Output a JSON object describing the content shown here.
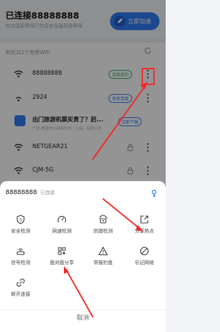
{
  "header": {
    "title": "已连接88888888",
    "subtitle": "符合国家等保行信息安全最高保等保",
    "accelerate_label": "立即加速"
  },
  "nearby_label": "附近共2个免费WiFi",
  "networks": [
    {
      "name": "88888888",
      "badge": "连接成功",
      "kind": "connected"
    },
    {
      "name": "2924",
      "badge": "免密连接",
      "kind": "free"
    },
    {
      "name": "出门旅游机票买贵了？赶...",
      "sub": "广告 携程旅行网络科技（上海）有限公司",
      "badge": "立即下载",
      "kind": "ad"
    },
    {
      "name": "NETGEAR21",
      "kind": "locked"
    },
    {
      "name": "CJM-5G",
      "kind": "locked"
    }
  ],
  "sheet": {
    "ssid": "88888888",
    "status": "已连接",
    "actions": [
      {
        "label": "安全检测",
        "icon": "shield-s-icon"
      },
      {
        "label": "网速检测",
        "icon": "speedometer-icon"
      },
      {
        "label": "防蹭检测",
        "icon": "anti-leech-icon"
      },
      {
        "label": "分享热点",
        "icon": "share-icon"
      },
      {
        "label": "信号检测",
        "icon": "router-icon"
      },
      {
        "label": "面对面分享",
        "icon": "qr-code-icon"
      },
      {
        "label": "举报钓鱼",
        "icon": "warning-icon"
      },
      {
        "label": "忘记网络",
        "icon": "forbidden-icon"
      },
      {
        "label": "断开连接",
        "icon": "broken-link-icon"
      }
    ],
    "cancel_label": "取消"
  },
  "colors": {
    "accent": "#2f7df6",
    "success": "#2aa56b",
    "annotation": "#ee2a2a"
  }
}
